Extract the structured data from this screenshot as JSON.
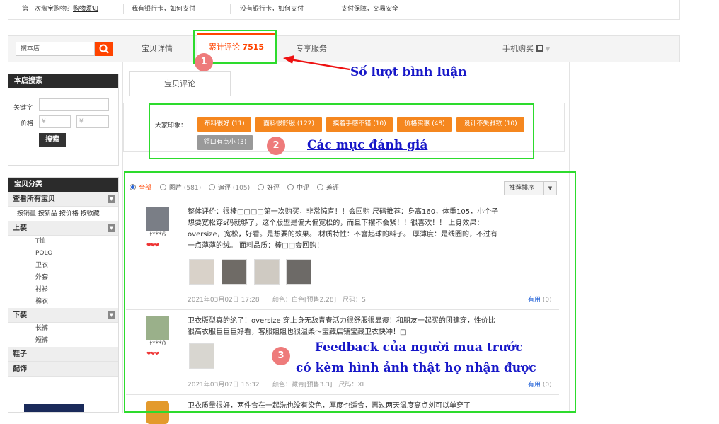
{
  "topbar": {
    "first_time": "第一次淘宝购物？",
    "first_time_link": "购物须知",
    "have_card": "我有银行卡，如何支付",
    "no_card": "没有银行卡，如何支付",
    "guarantee": "支付保障，交易安全"
  },
  "tabs": {
    "search_placeholder": "搜本店",
    "detail": "宝贝详情",
    "reviews_label": "累计评论",
    "reviews_count": "7515",
    "service": "专享服务",
    "mobile": "手机购买"
  },
  "annotations": {
    "one": "1",
    "one_text": "Số lượt bình luận",
    "two": "2",
    "two_text": "Các mục đánh giá",
    "three": "3",
    "three_line1": "Feedback của người mua trước",
    "three_line2": "có kèm hình ảnh thật họ nhận được"
  },
  "sidebar": {
    "search_title": "本店搜索",
    "keyword_label": "关键字",
    "price_label": "价格",
    "price_symbol": "¥",
    "search_button": "搜索",
    "cat_title": "宝贝分类",
    "all": "查看所有宝贝",
    "sorts": "按销量 按新品 按价格 按收藏",
    "groups": [
      {
        "label": "上装",
        "items": [
          "T恤",
          "POLO",
          "卫衣",
          "外套",
          "衬衫",
          "棉衣"
        ]
      },
      {
        "label": "下装",
        "items": [
          "长裤",
          "短裤"
        ]
      }
    ],
    "shoes": "鞋子",
    "accessories": "配饰"
  },
  "main": {
    "inner_tab": "宝贝评论",
    "impression_label": "大家印象：",
    "tags": [
      "布料很好 (11)",
      "面料很舒服 (122)",
      "摸着手感不错 (10)",
      "价格实惠 (48)",
      "设计不失雅致 (10)",
      "領口有点小 (3)"
    ],
    "filters": {
      "all": "全部",
      "pics": "图片",
      "pics_count": "(581)",
      "append": "追评",
      "append_count": "(105)",
      "good": "好评",
      "mid": "中评",
      "bad": "差评"
    },
    "sort": "推荐排序",
    "reviews": [
      {
        "user": "t***6",
        "text_lines": [
          "整体评价：很棒□□□□第一次购买，非常惊喜！！会回购 尺码推荐：身高160，体重105，小个子",
          "想要宽松穿s码就够了，这个版型是偏大偏宽松的，而且下摆不会紧！！很喜欢！！ 上身效果：",
          "oversize，宽松，好看。是想要的效果。 材质特性：不會起球的料子。 厚薄度：是线圈的，不过有",
          "一点薄薄的绒。 面料品质：棒□□会回购！"
        ],
        "date": "2021年03月02日 17:28",
        "spec": "颜色：白色[预售2.28]　尺码：S",
        "useful": "有用",
        "useful_count": "(0)"
      },
      {
        "user": "t***0",
        "text_lines": [
          "卫衣版型真的绝了！oversize 穿上身无敌青春活力很舒服很显瘦！和朋友一起买的团建穿，性价比",
          "很高衣服巨巨巨好看，客服姐姐也很温柔～宝藏店铺宝藏卫衣快冲！□"
        ],
        "date": "2021年03月07日 16:32",
        "spec": "颜色：藏青[预售3.3]　尺码：XL",
        "useful": "有用",
        "useful_count": "(0)"
      },
      {
        "user": "",
        "text_lines": [
          "卫衣质量很好，两件合在一起洗也没有染色，厚度也适合，再过两天温度高点刘可以单穿了"
        ]
      }
    ]
  }
}
